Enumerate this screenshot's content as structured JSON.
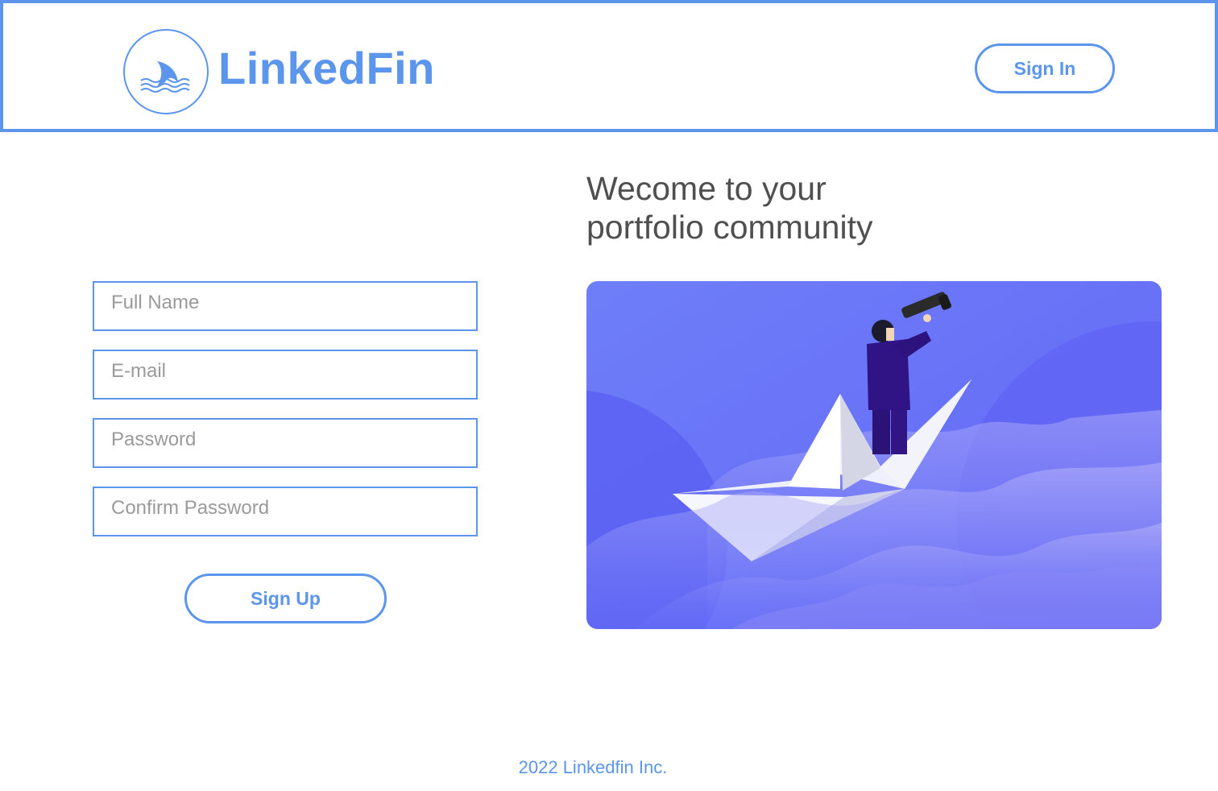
{
  "header": {
    "brand_name": "LinkedFin",
    "logo_icon": "shark-fin-waves-icon",
    "sign_in_label": "Sign In",
    "accent_color": "#5b95ec"
  },
  "signup_form": {
    "full_name": {
      "placeholder": "Full Name",
      "value": ""
    },
    "email": {
      "placeholder": "E-mail",
      "value": ""
    },
    "password": {
      "placeholder": "Password",
      "value": ""
    },
    "confirm_password": {
      "placeholder": "Confirm Password",
      "value": ""
    },
    "submit_label": "Sign Up"
  },
  "hero": {
    "headline_line1": "Wecome to your",
    "headline_line2": "portfolio community",
    "illustration": "man-with-telescope-on-paper-boat",
    "colors": {
      "background": "#6b79f7",
      "waves": "#8f94f7",
      "boat": "#f3f4fb",
      "suit": "#2e137f"
    }
  },
  "footer": {
    "copyright": "2022 Linkedfin Inc."
  }
}
